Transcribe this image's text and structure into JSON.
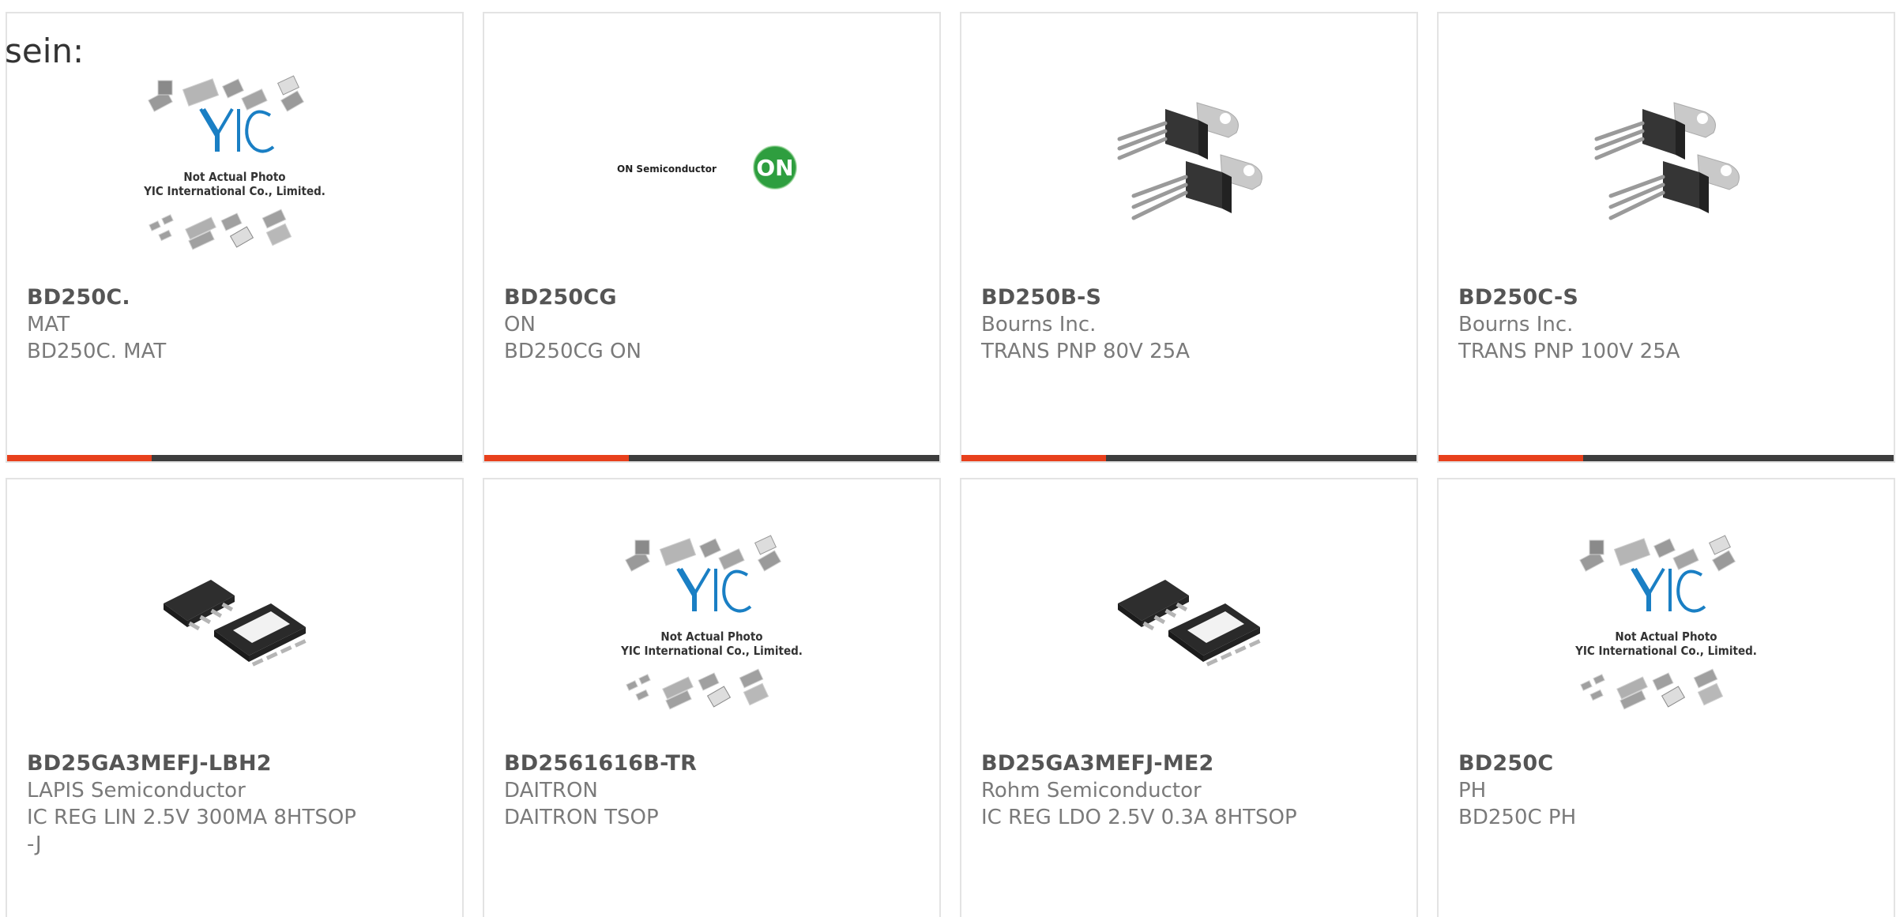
{
  "section_title": "sein:",
  "placeholder": {
    "logo": "YIC",
    "line1": "Not Actual Photo",
    "line2": "YIC International Co., Limited."
  },
  "on_logo": {
    "brand": "ON Semiconductor",
    "mark": "ON"
  },
  "colors": {
    "accent": "#e8401c",
    "bar": "#3d3d3d",
    "border": "#e3e3e3",
    "yic_blue": "#1a7fc4",
    "on_green": "#2e9e3f"
  },
  "products": [
    {
      "part": "BD250C.",
      "maker": "MAT",
      "desc": "BD250C. MAT",
      "image": "yic-placeholder"
    },
    {
      "part": "BD250CG",
      "maker": "ON",
      "desc": "BD250CG ON",
      "image": "on-semiconductor-logo"
    },
    {
      "part": "BD250B-S",
      "maker": "Bourns Inc.",
      "desc": "TRANS PNP 80V 25A",
      "image": "to220-transistors"
    },
    {
      "part": "BD250C-S",
      "maker": "Bourns Inc.",
      "desc": "TRANS PNP 100V 25A",
      "image": "to220-transistors"
    },
    {
      "part": "BD25GA3MEFJ-LBH2",
      "maker": "LAPIS Semiconductor",
      "desc": "IC REG LIN 2.5V 300MA 8HTSOP-J",
      "image": "htsop-chip"
    },
    {
      "part": "BD2561616B-TR",
      "maker": "DAITRON",
      "desc": "DAITRON TSOP",
      "image": "yic-placeholder"
    },
    {
      "part": "BD25GA3MEFJ-ME2",
      "maker": "Rohm Semiconductor",
      "desc": "IC REG LDO 2.5V 0.3A 8HTSOP",
      "image": "htsop-chip"
    },
    {
      "part": "BD250C",
      "maker": "PH",
      "desc": "BD250C PH",
      "image": "yic-placeholder"
    }
  ]
}
